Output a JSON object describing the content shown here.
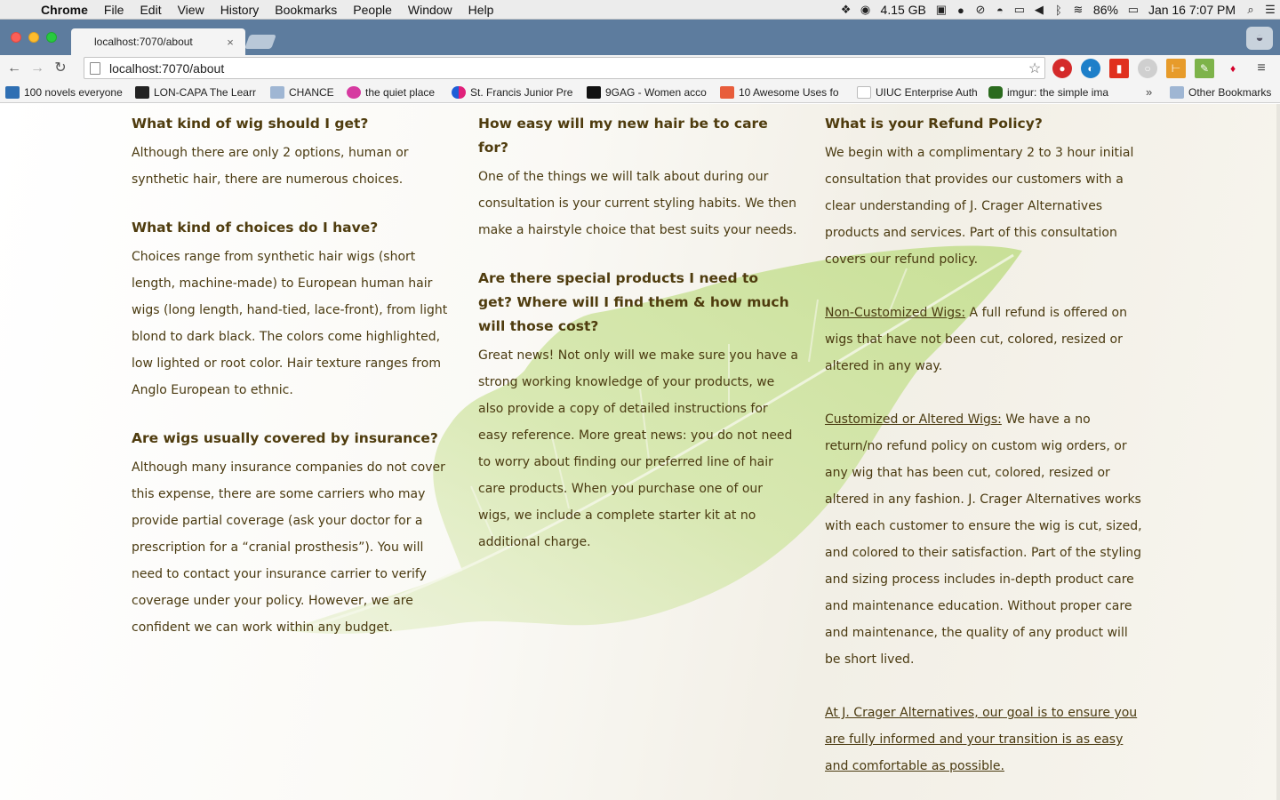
{
  "menubar": {
    "app": "Chrome",
    "items": [
      "File",
      "Edit",
      "View",
      "History",
      "Bookmarks",
      "People",
      "Window",
      "Help"
    ],
    "memory": "4.15 GB",
    "battery": "86%",
    "datetime": "Jan 16  7:07 PM"
  },
  "tab": {
    "title": "localhost:7070/about",
    "close_label": "×"
  },
  "toolbar": {
    "url": "localhost:7070/about",
    "back_label": "←",
    "forward_label": "→",
    "reload_label": "↻",
    "star_label": "☆"
  },
  "bookmarks": {
    "items": [
      {
        "label": "100 novels everyone",
        "color": "#2f6fb3"
      },
      {
        "label": "LON-CAPA The Learr",
        "color": "#222222"
      },
      {
        "label": "CHANCE",
        "color": "#9fb6d3"
      },
      {
        "label": "the quiet place",
        "color": "#d63aa0"
      },
      {
        "label": "St. Francis Junior Pre",
        "color": "#1e5fd8"
      },
      {
        "label": "9GAG - Women acco",
        "color": "#111111"
      },
      {
        "label": "10 Awesome Uses fo",
        "color": "#e85d3b"
      },
      {
        "label": "UIUC Enterprise Auth",
        "color": "#bbbbbb"
      },
      {
        "label": "imgur: the simple ima",
        "color": "#2b6b1e"
      }
    ],
    "overflow": "»",
    "other": "Other Bookmarks"
  },
  "page": {
    "col1": {
      "q1": "What kind of wig should I get?",
      "a1": "Although there are only 2 options, human or synthetic hair, there are numerous choices.",
      "q2": "What kind of choices do I have?",
      "a2": "Choices range from synthetic hair wigs (short length, machine-made) to European human hair wigs (long length, hand-tied, lace-front), from light blond to dark black. The colors come highlighted, low lighted or root color. Hair texture ranges from Anglo European to ethnic.",
      "q3": "Are wigs usually covered by insurance?",
      "a3": "Although many insurance companies do not cover this expense, there are some carriers who may provide partial coverage (ask your doctor for a prescription for a “cranial prosthesis”). You will need to contact your insurance carrier to verify coverage under your policy. However, we are confident we can work within any budget."
    },
    "col2": {
      "q1": "How easy will my new hair be to care for?",
      "a1": "One of the things we will talk about during our consultation is your current styling habits. We then make a hairstyle choice that best suits your needs.",
      "q2": "Are there special products I need to get? Where will I find them & how much will those cost?",
      "a2": "Great news! Not only will we make sure you have a strong working knowledge of your products, we also provide a copy of detailed instructions for easy reference. More great news: you do not need to worry about finding our preferred line of hair care products. When you purchase one of our wigs, we include a complete starter kit at no additional charge."
    },
    "col3": {
      "q1": "What is your Refund Policy?",
      "a1": "We begin with a complimentary 2 to 3 hour initial consultation that provides our customers with a clear understanding of J. Crager Alternatives products and services. Part of this consultation covers our refund policy.",
      "noncustom_label": "Non-Customized Wigs:",
      "noncustom_text": " A full refund is offered on wigs that have not been cut, colored, resized or altered in any way.",
      "custom_label": "Customized or Altered Wigs:",
      "custom_text": " We have a no return/no refund policy on custom wig orders, or any wig that has been cut, colored, resized or altered in any fashion. J. Crager Alternatives works with each customer to ensure the wig is cut, sized, and colored to their satisfaction. Part of the styling and sizing process includes in-depth product care and maintenance education. Without proper care and maintenance, the quality of any product will be short lived.",
      "closing": "At J. Crager Alternatives, our goal is to ensure you are fully informed and your transition is as easy and comfortable as possible."
    }
  },
  "colors": {
    "heading": "#4f3c0e",
    "body_text": "#4a3a10",
    "leaf": "#c9e09a",
    "chrome_frame": "#5d7c9e"
  }
}
